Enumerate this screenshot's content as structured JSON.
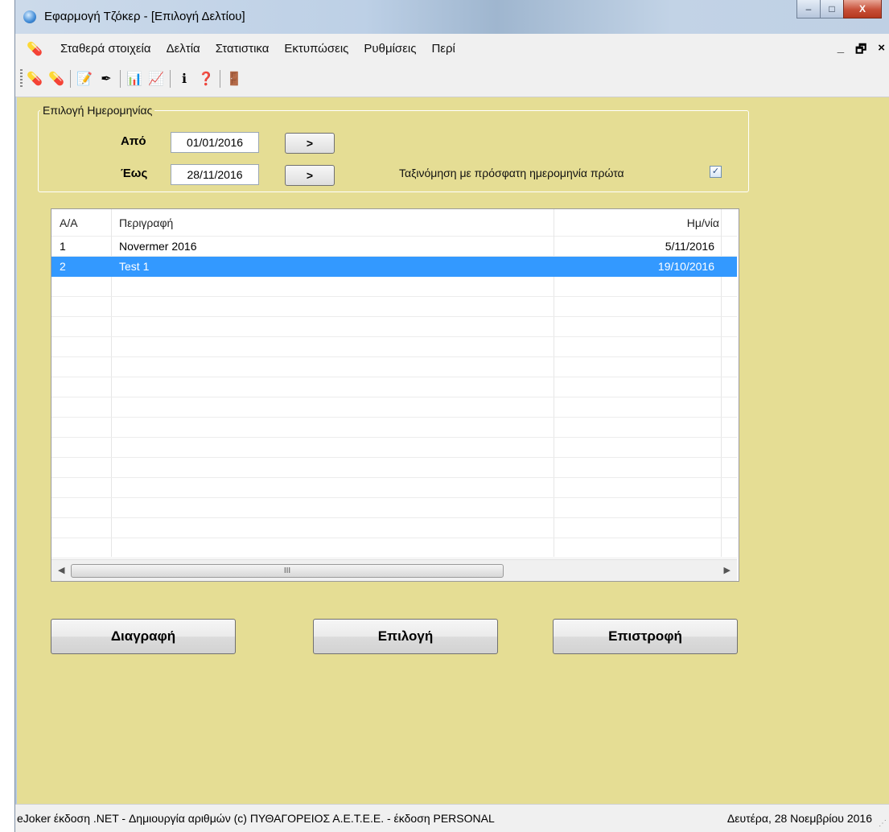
{
  "window": {
    "title": "Εφαρμογή Τζόκερ - [Επιλογή Δελτίου]",
    "controls": {
      "minimize": "–",
      "maximize": "□",
      "close": "X"
    }
  },
  "menubar": {
    "items": [
      "Σταθερά στοιχεία",
      "Δελτία",
      "Στατιστικα",
      "Εκτυπώσεις",
      "Ρυθμίσεις",
      "Περί"
    ],
    "mdi_controls": {
      "minimize": "_",
      "restore": "🗗",
      "close": "×"
    }
  },
  "toolbar": {
    "icons": [
      "pills-icon",
      "capsule-icon",
      "edit-document-icon",
      "pen-icon",
      "statistics-icon",
      "chart-icon",
      "info-icon",
      "help-icon",
      "exit-door-icon"
    ]
  },
  "date_group": {
    "legend": "Επιλογή Ημερομηνίας",
    "from_label": "Από",
    "from_value": "01/01/2016",
    "to_label": "Έως",
    "to_value": "28/11/2016",
    "arrow_label": ">",
    "sort_label": "Ταξινόμηση με πρόσφατη ημερομηνία πρώτα",
    "sort_checked": true,
    "check_mark": "✓"
  },
  "grid": {
    "columns": [
      "Α/Α",
      "Περιγραφή",
      "Ημ/νία"
    ],
    "rows": [
      {
        "aa": "1",
        "description": "Novermer 2016",
        "date": "5/11/2016",
        "selected": false
      },
      {
        "aa": "2",
        "description": "Test 1",
        "date": "19/10/2016",
        "selected": true
      }
    ],
    "scroll_thumb_glyph": "III"
  },
  "buttons": {
    "delete": "Διαγραφή",
    "select": "Επιλογή",
    "back": "Επιστροφή"
  },
  "statusbar": {
    "left": "eJoker έκδοση .NET  - Δημιουργία αριθμών  (c) ΠΥΘΑΓΟΡΕΙΟΣ  Α.Ε.Τ.Ε.Ε.  - έκδοση PERSONAL",
    "right": "Δευτέρα, 28 Νοεμβρίου 2016"
  },
  "colors": {
    "client_bg": "#e5dd94",
    "selection": "#3399ff"
  }
}
